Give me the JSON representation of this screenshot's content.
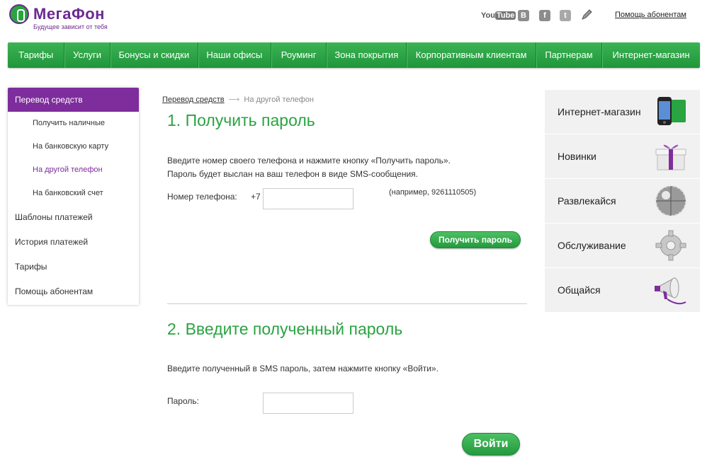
{
  "header": {
    "brand": "МегаФон",
    "slogan": "Будущее зависит от тебя",
    "social": {
      "youtube_a": "You",
      "youtube_b": "Tube",
      "vk": "B",
      "facebook": "f",
      "twitter": "t"
    },
    "help_link": "Помощь абонентам"
  },
  "nav": {
    "items": [
      "Тарифы",
      "Услуги",
      "Бонусы и скидки",
      "Наши офисы",
      "Роуминг",
      "Зона покрытия",
      "Корпоративным клиентам",
      "Партнерам",
      "Интернет-магазин"
    ]
  },
  "sidebar": {
    "header": "Перевод средств",
    "subitems": [
      "Получить наличные",
      "На банковскую карту",
      "На другой телефон",
      "На банковский счет"
    ],
    "active_subitem": "На другой телефон",
    "items": [
      "Шаблоны платежей",
      "История платежей",
      "Тарифы",
      "Помощь абонентам"
    ]
  },
  "breadcrumb": {
    "link": "Перевод средств",
    "arrow": "⟶",
    "current": "На другой телефон"
  },
  "step1": {
    "title": "1. Получить пароль",
    "line1": "Введите номер своего телефона и нажмите кнопку «Получить пароль».",
    "line2": "Пароль будет выслан на ваш телефон в виде SMS-сообщения.",
    "phone_label": "Номер телефона:",
    "phone_prefix": "+7",
    "phone_value": "",
    "hint": "(например, 9261110505)",
    "button": "Получить пароль"
  },
  "step2": {
    "title": "2. Введите полученный пароль",
    "line1": "Введите полученный в SMS пароль, затем нажмите кнопку «Войти».",
    "password_label": "Пароль:",
    "password_value": "",
    "button": "Войти"
  },
  "promo": {
    "items": [
      {
        "label": "Интернет-магазин",
        "icon": "phone-icon"
      },
      {
        "label": "Новинки",
        "icon": "gift-icon"
      },
      {
        "label": "Развлекайся",
        "icon": "disco-ball-icon"
      },
      {
        "label": "Обслуживание",
        "icon": "gear-icon"
      },
      {
        "label": "Общайся",
        "icon": "megaphone-icon"
      }
    ]
  },
  "colors": {
    "brand_green": "#2aa341",
    "brand_purple": "#7e2d9c",
    "promo_bg": "#f1f1f1"
  }
}
